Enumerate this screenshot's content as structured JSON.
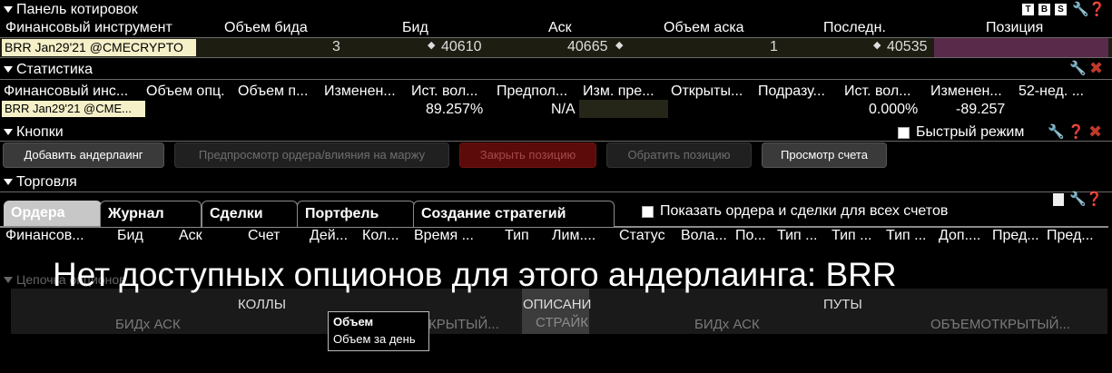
{
  "quote_panel": {
    "title": "Панель котировок",
    "icons": [
      "T",
      "B",
      "S"
    ],
    "columns": [
      "Финансовый инструмент",
      "Объем бида",
      "Бид",
      "Аск",
      "Объем аска",
      "Последн.",
      "Позиция"
    ],
    "row": {
      "instrument": "BRR Jan29'21 @CMECRYPTO",
      "bid_size": "3",
      "bid": "40610",
      "ask": "40665",
      "ask_size": "1",
      "last": "40535"
    }
  },
  "statistics": {
    "title": "Статистика",
    "columns": [
      "Финансовый инс...",
      "Объем опц.",
      "Объем п...",
      "Изменен...",
      "Ист. вол...",
      "Предпол...",
      "Изм. пре...",
      "Открыты...",
      "Подразу...",
      "Ист. вол...",
      "Изменен...",
      "52-нед. ..."
    ],
    "row": {
      "instrument": "BRR Jan29'21 @CME...",
      "hist_vol": "89.257%",
      "implied": "N/A",
      "change_pct": "0.000%",
      "change": "-89.257"
    }
  },
  "buttons_panel": {
    "title": "Кнопки",
    "fast_mode_label": "Быстрый режим",
    "buttons": {
      "add_underlying": "Добавить андерлаинг",
      "preview_order": "Предпросмотр ордера/влияния на маржу",
      "close_position": "Закрыть позицию",
      "reverse_position": "Обратить позицию",
      "view_account": "Просмотр счета"
    }
  },
  "trading": {
    "title": "Торговля",
    "tabs": [
      "Ордера",
      "Журнал",
      "Сделки",
      "Портфель",
      "Создание стратегий"
    ],
    "show_all_label": "Показать ордера и сделки для всех счетов",
    "columns": [
      "Финансов...",
      "Бид",
      "Аск",
      "Счет",
      "Дей...",
      "Кол...",
      "Время ...",
      "Тип",
      "Лим....",
      "Статус",
      "Вола...",
      "По...",
      "Тип ...",
      "Тип ...",
      "Тип ...",
      "Доп....",
      "Пред...",
      "Пред..."
    ]
  },
  "option_chain": {
    "title": "Цепочка опционов",
    "calls": "КОЛЛЫ",
    "description": "ОПИСАНИ",
    "puts": "ПУТЫ",
    "strike": "СТРАЙК",
    "calls_bid_ask": "БИДx АСК",
    "calls_oi": "КРЫТЫЙ...",
    "puts_bid_ask": "БИДx АСК",
    "puts_vol_oi": "ОБЪЕМОТКРЫТЫЙ..."
  },
  "overlay_message": "Нет доступных опционов для этого андерлаинга: BRR",
  "tooltip": {
    "title": "Объем",
    "text": "Объем за день"
  },
  "colors": {
    "instrument_bg": "#f5f0c8",
    "position_cell": "#5a2a4a",
    "bid_cell": "#262618",
    "close_btn": "#5c0a0a"
  }
}
